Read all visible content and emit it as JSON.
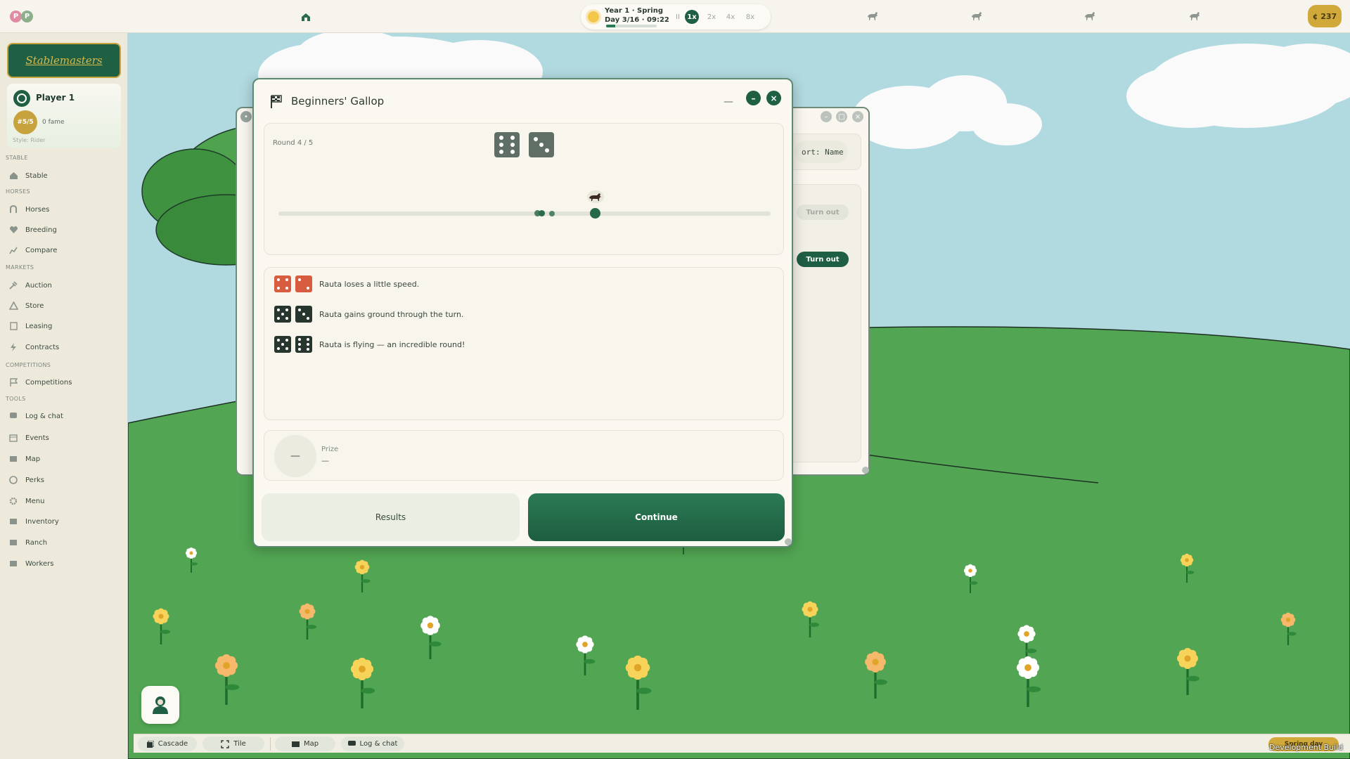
{
  "topbar": {
    "players": [
      "P",
      "P"
    ],
    "date_line1": "Year 1 · Spring",
    "date_line2": "Day 3/16 · 09:22",
    "day_progress": 0.18,
    "speeds": [
      "II",
      "1x",
      "2x",
      "4x",
      "8x"
    ],
    "active_speed": "1x",
    "money": "¢ 237"
  },
  "sidebar": {
    "logo": "Stablemasters",
    "player": {
      "name": "Player 1",
      "rank": "#5/5",
      "fame": "0 fame",
      "style": "Style: Rider"
    },
    "sections": {
      "stable": "STABLE",
      "horses": "HORSES",
      "markets": "MARKETS",
      "competitions": "COMPETITIONS",
      "tools": "TOOLS"
    },
    "items": {
      "stable": "Stable",
      "horses": "Horses",
      "breeding": "Breeding",
      "compare": "Compare",
      "auction": "Auction",
      "store": "Store",
      "leasing": "Leasing",
      "contracts": "Contracts",
      "competitions": "Competitions",
      "log_chat": "Log & chat",
      "events": "Events",
      "map": "Map",
      "perks": "Perks",
      "menu": "Menu",
      "inventory": "Inventory",
      "ranch": "Ranch",
      "workers": "Workers"
    }
  },
  "back_window": {
    "sort_label": "ort: Name",
    "turn_out_disabled": "Turn out",
    "turn_out": "Turn out"
  },
  "dialog": {
    "title": "Beginners' Gallop",
    "minimize_line": "—",
    "round": "Round 4 / 5",
    "current_dice": [
      6,
      3
    ],
    "log": [
      {
        "dice": [
          4,
          2
        ],
        "color": "#d85c3f",
        "text": "Rauta loses a little speed."
      },
      {
        "dice": [
          5,
          3
        ],
        "color": "#26352d",
        "text": "Rauta gains ground through the turn."
      },
      {
        "dice": [
          5,
          6
        ],
        "color": "#26352d",
        "text": "Rauta is flying — an incredible round!"
      }
    ],
    "prize_circle": "—",
    "prize_label": "Prize",
    "prize_value": "—",
    "results_label": "Results",
    "continue_label": "Continue"
  },
  "taskbar": {
    "cascade": "Cascade",
    "tile": "Tile",
    "map": "Map",
    "log_chat": "Log & chat",
    "season": "Spring day",
    "build": "Development Build"
  },
  "colors": {
    "accent": "#1f5f43",
    "gold": "#d0a93a",
    "grass": "#58a95a",
    "sky": "#b1d9e0"
  }
}
